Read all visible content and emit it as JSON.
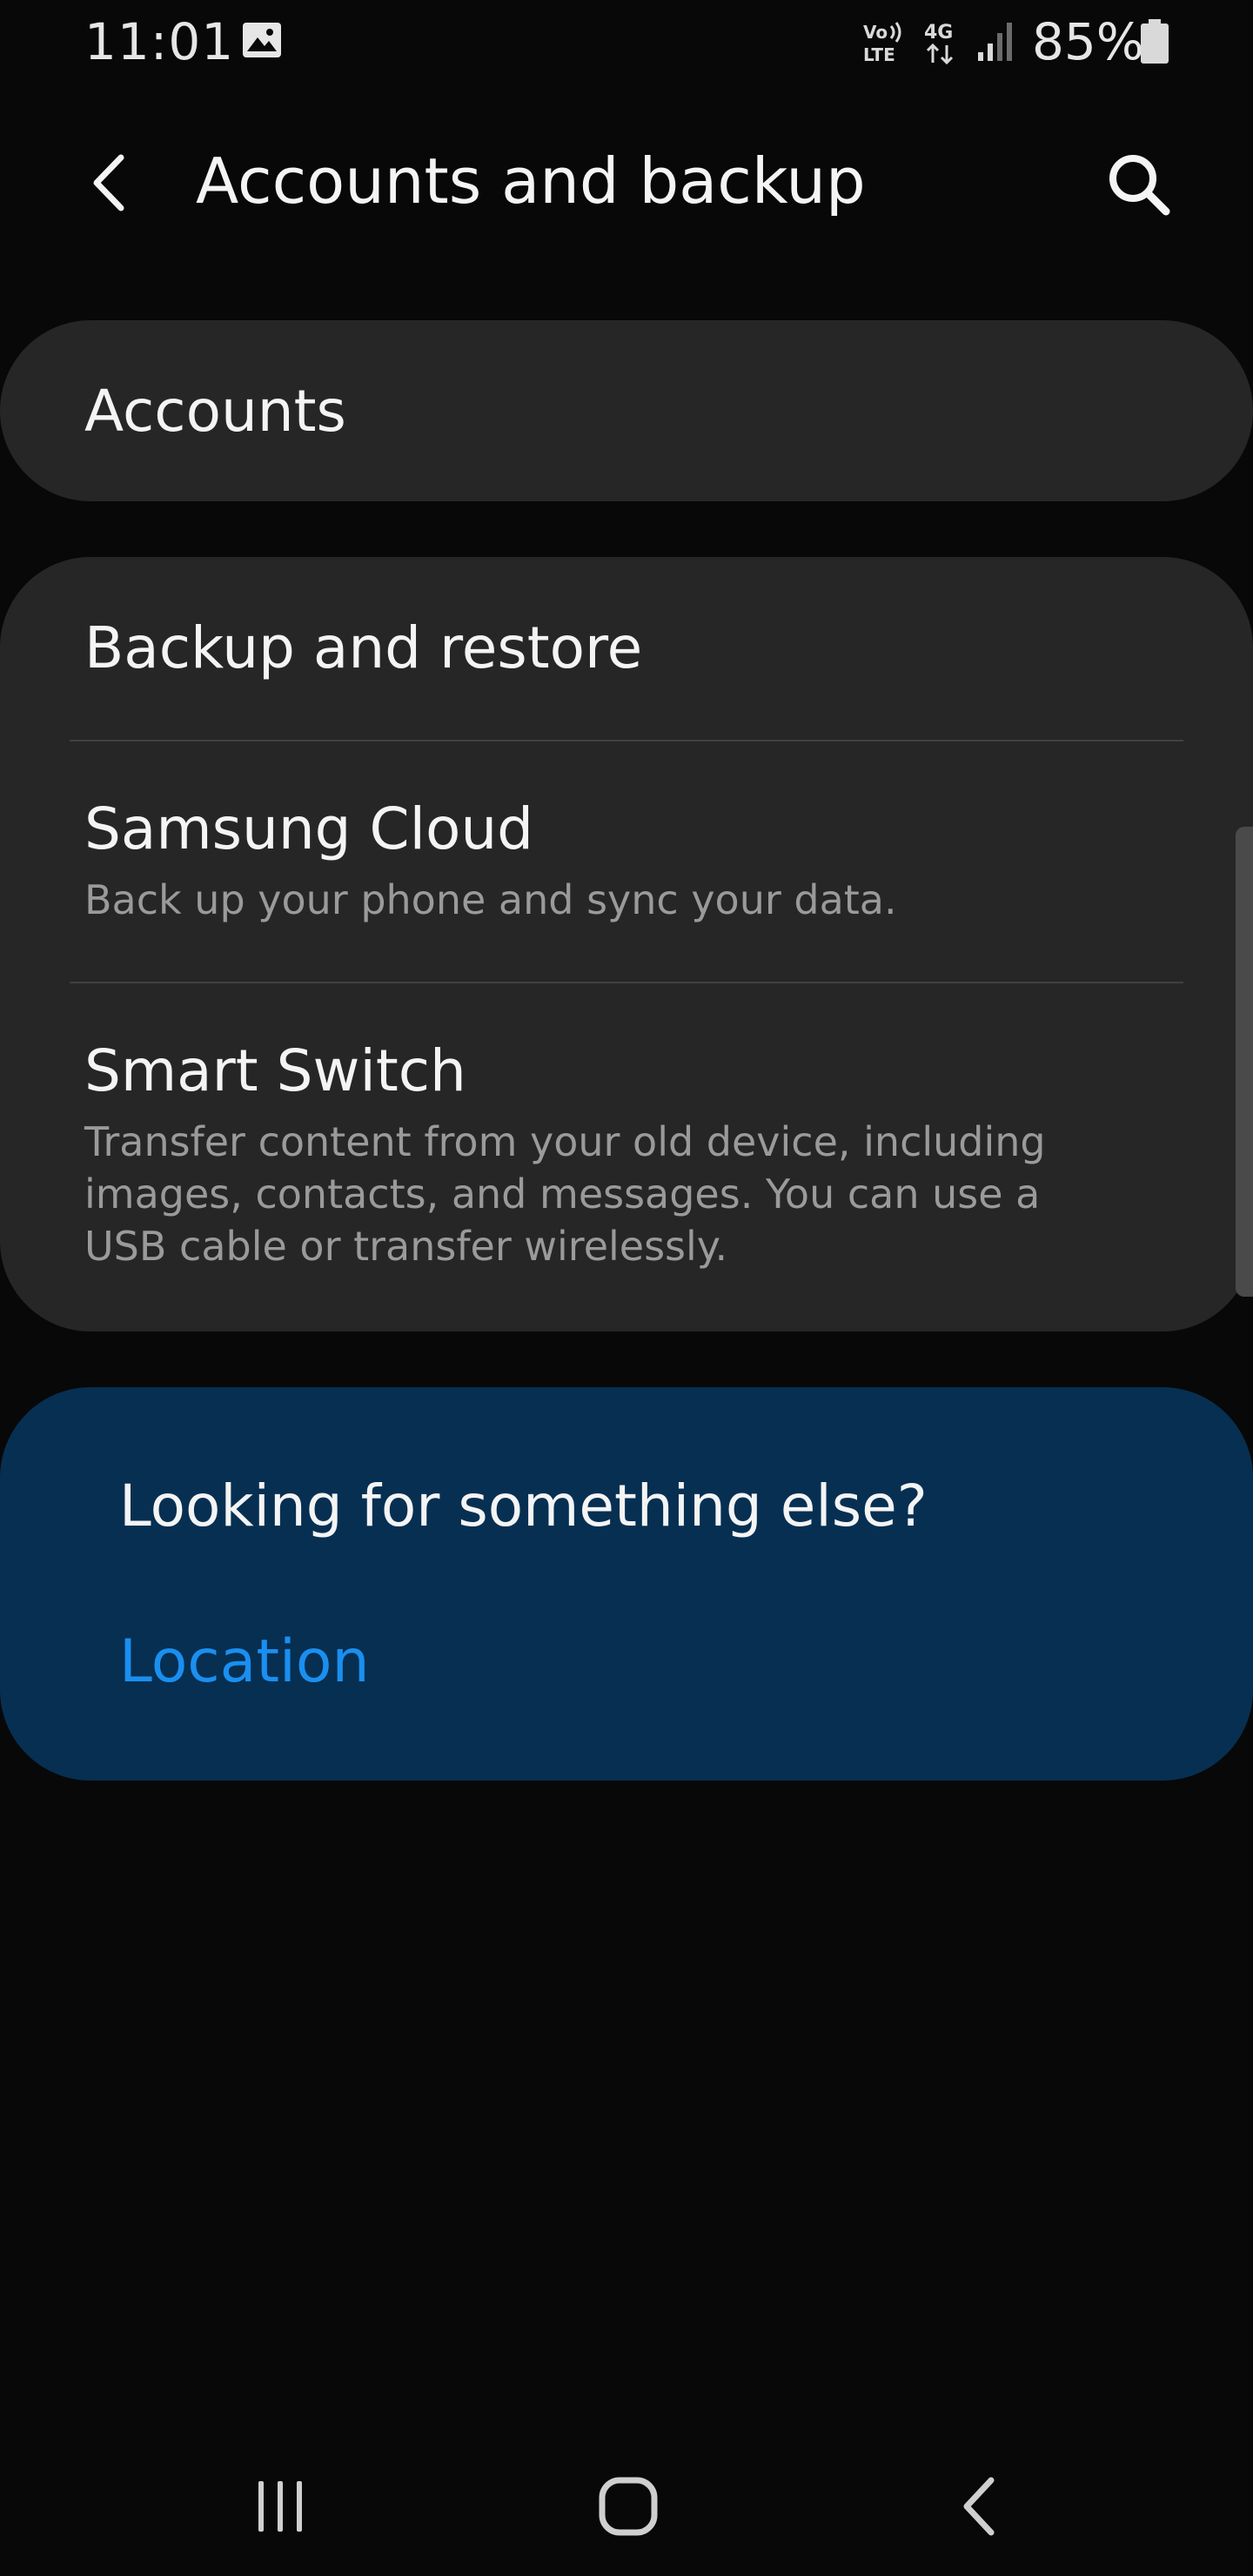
{
  "status_bar": {
    "time": "11:01",
    "battery_percent": "85%",
    "icons": [
      "image-icon",
      "volte-icon",
      "lte-4g-icon",
      "signal-icon",
      "battery-icon"
    ]
  },
  "app_bar": {
    "title": "Accounts and backup",
    "back_icon": "chevron-left-icon",
    "search_icon": "search-icon"
  },
  "accounts_card": {
    "title": "Accounts"
  },
  "backup_card": {
    "items": [
      {
        "title": "Backup and restore",
        "subtitle": ""
      },
      {
        "title": "Samsung Cloud",
        "subtitle": "Back up your phone and sync your data."
      },
      {
        "title": "Smart Switch",
        "subtitle": "Transfer content from your old device, including images, contacts, and messages. You can use a USB cable or transfer wirelessly."
      }
    ]
  },
  "suggestion": {
    "title": "Looking for something else?",
    "link": "Location"
  },
  "nav_bar": {
    "icons": [
      "recents-icon",
      "home-icon",
      "back-icon"
    ]
  },
  "colors": {
    "background": "#080808",
    "card": "#262626",
    "suggestion_card": "#062f52",
    "link": "#1a8ff0",
    "subtitle": "#9a9a9a"
  }
}
